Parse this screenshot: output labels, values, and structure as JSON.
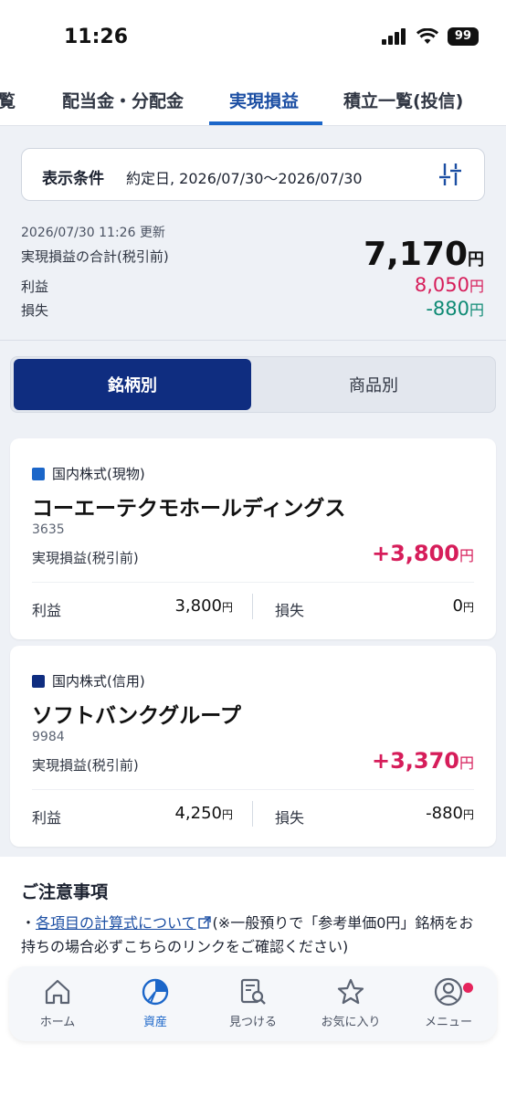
{
  "status_bar": {
    "time": "11:26",
    "battery": "99"
  },
  "tabs": [
    {
      "label": "覧"
    },
    {
      "label": "配当金・分配金"
    },
    {
      "label": "実現損益"
    },
    {
      "label": "積立一覧(投信)"
    }
  ],
  "condition": {
    "label": "表示条件",
    "value": "約定日, 2026/07/30〜2026/07/30"
  },
  "summary": {
    "updated": "2026/07/30 11:26 更新",
    "total_label": "実現損益の合計(税引前)",
    "total_value": "7,170",
    "profit_label": "利益",
    "profit_value": "8,050",
    "loss_label": "損失",
    "loss_value": "-880",
    "yen": "円"
  },
  "segmented": {
    "by_stock": "銘柄別",
    "by_product": "商品別"
  },
  "cards": [
    {
      "category": "国内株式(現物)",
      "category_color": "#1b66c9",
      "name": "コーエーテクモホールディングス",
      "code": "3635",
      "pl_label": "実現損益(税引前)",
      "pl_value": "+3,800",
      "gain_label": "利益",
      "gain_value": "3,800",
      "loss_label": "損失",
      "loss_value": "0"
    },
    {
      "category": "国内株式(信用)",
      "category_color": "#0f2d80",
      "name": "ソフトバンクグループ",
      "code": "9984",
      "pl_label": "実現損益(税引前)",
      "pl_value": "+3,370",
      "gain_label": "利益",
      "gain_value": "4,250",
      "loss_label": "損失",
      "loss_value": "-880"
    }
  ],
  "notes": {
    "title": "ご注意事項",
    "bullet": "・",
    "link": "各項目の計算式について",
    "text": "(※一般預りで「参考単価0円」銘柄をお持ちの場合必ずこちらのリンクをご確認ください)"
  },
  "bottom_nav": [
    {
      "label": "ホーム",
      "icon": "home-icon"
    },
    {
      "label": "資産",
      "icon": "pie-chart-icon"
    },
    {
      "label": "見つける",
      "icon": "search-document-icon"
    },
    {
      "label": "お気に入り",
      "icon": "star-icon"
    },
    {
      "label": "メニュー",
      "icon": "user-icon"
    }
  ],
  "colors": {
    "accent": "#1b66c9",
    "navy": "#0f2d80",
    "profit": "#d61d5a",
    "loss": "#0e8a74"
  }
}
